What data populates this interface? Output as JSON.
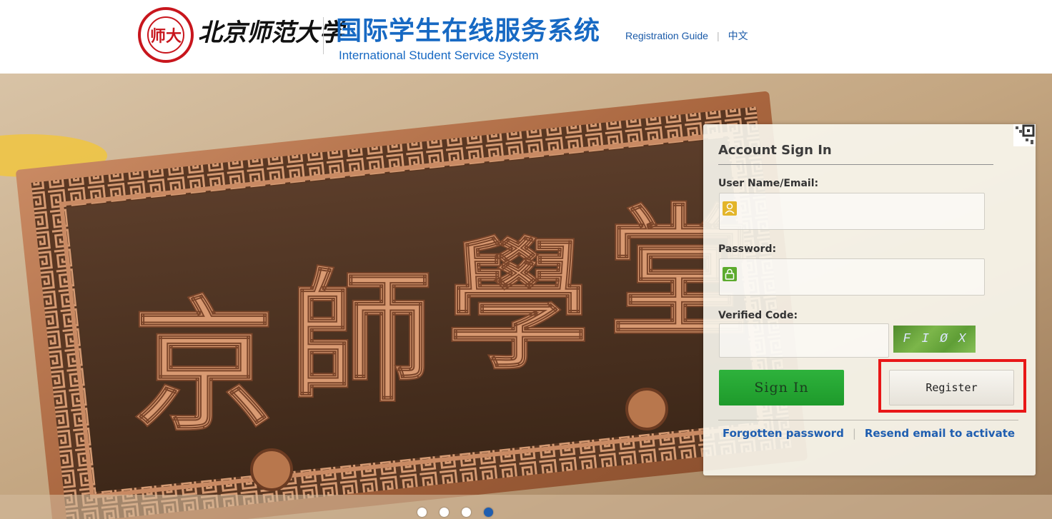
{
  "header": {
    "university_name": "北京师范大学",
    "seal_text": "师大",
    "system_name_cn": "国际学生在线服务系统",
    "system_name_en": "International Student Service System",
    "links": {
      "guide": "Registration Guide",
      "language": "中文"
    }
  },
  "banner": {
    "plaque_text": "京 師 學 堂",
    "carousel": {
      "slide_count": 4,
      "active_index": 3
    }
  },
  "login": {
    "title": "Account Sign In",
    "username": {
      "label": "User Name/Email:",
      "value": "",
      "placeholder": "",
      "icon": "user-icon"
    },
    "password": {
      "label": "Password:",
      "value": "",
      "placeholder": "",
      "icon": "lock-icon"
    },
    "verified_code": {
      "label": "Verified Code:",
      "value": "",
      "placeholder": ""
    },
    "captcha_chars": [
      "F",
      "I",
      "Ø",
      "X"
    ],
    "sign_in_label": "Sign In",
    "register_label": "Register",
    "forgot_label": "Forgotten password",
    "resend_label": "Resend email to activate"
  },
  "colors": {
    "brand_blue": "#1769c3",
    "seal_red": "#c8161d",
    "sign_in_green": "#1e9a2b",
    "highlight_red": "#e81717",
    "link_blue": "#1f5eb0"
  }
}
